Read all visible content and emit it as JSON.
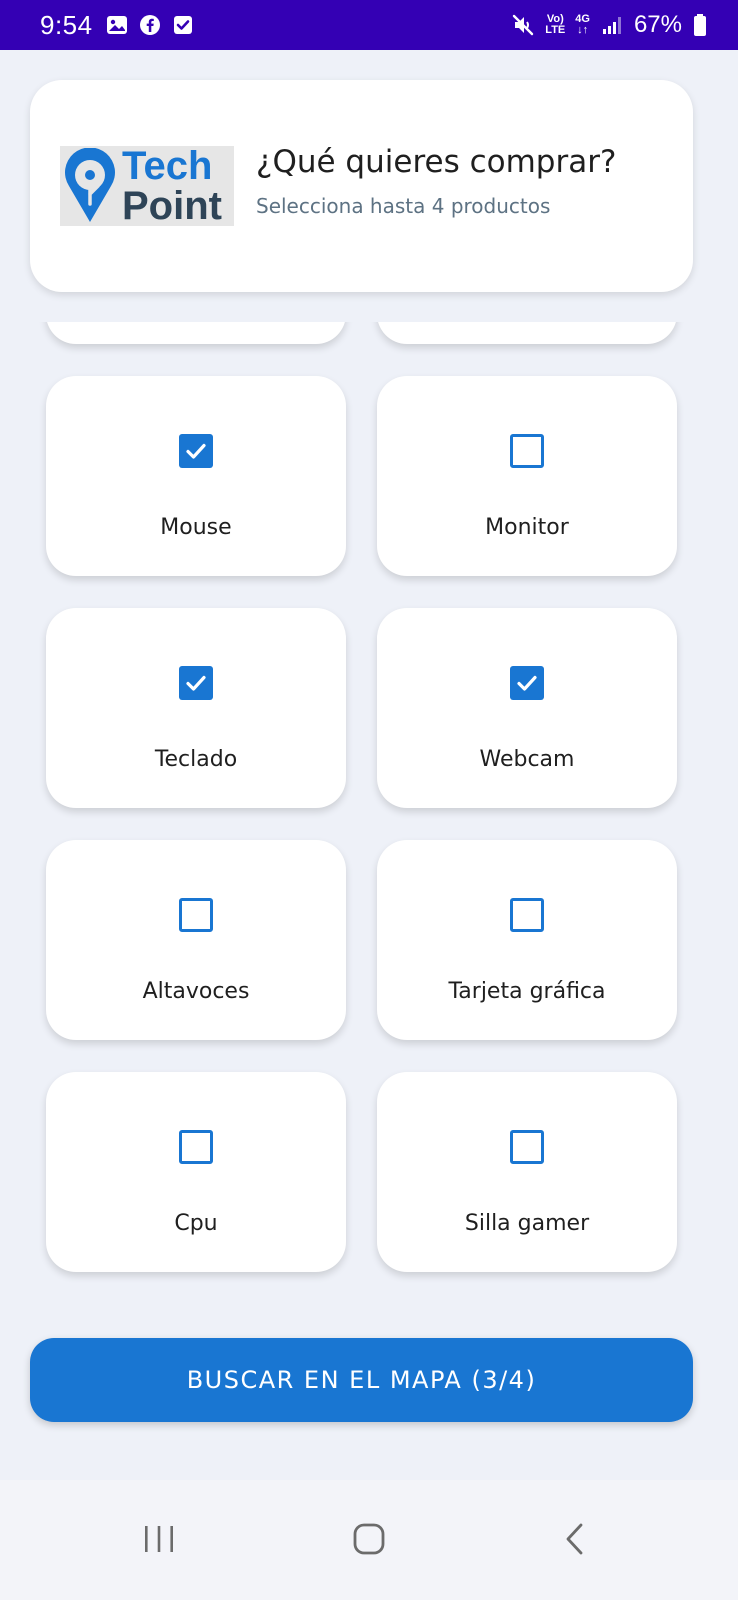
{
  "status_bar": {
    "time": "9:54",
    "network_top": "Vo)",
    "network_bottom": "LTE",
    "net_type_top": "4G",
    "battery": "67%"
  },
  "header": {
    "logo_line1": "Tech",
    "logo_line2": "Point",
    "title": "¿Qué quieres comprar?",
    "subtitle": "Selecciona hasta 4 productos"
  },
  "products": [
    {
      "label": "Mouse",
      "checked": true
    },
    {
      "label": "Monitor",
      "checked": false
    },
    {
      "label": "Teclado",
      "checked": true
    },
    {
      "label": "Webcam",
      "checked": true
    },
    {
      "label": "Altavoces",
      "checked": false
    },
    {
      "label": "Tarjeta gráfica",
      "checked": false
    },
    {
      "label": "Cpu",
      "checked": false
    },
    {
      "label": "Silla gamer",
      "checked": false
    }
  ],
  "search_button": {
    "label": "BUSCAR EN EL MAPA (3/4)"
  },
  "colors": {
    "accent": "#1976d2",
    "status_bar": "#3400b4",
    "background": "#eef1f8"
  }
}
